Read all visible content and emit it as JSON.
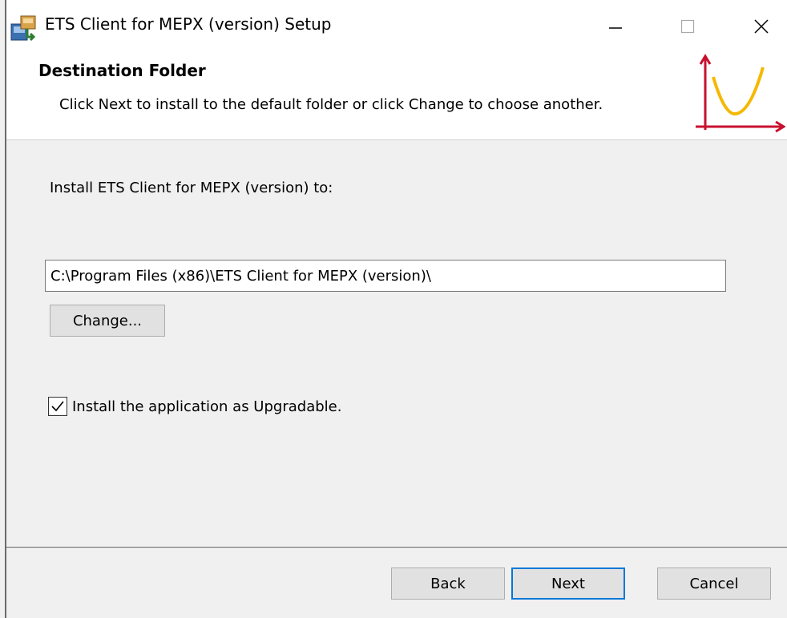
{
  "window": {
    "title": "ETS Client for MEPX (version) Setup"
  },
  "header": {
    "title": "Destination Folder",
    "subtitle": "Click Next to install to the default folder or click Change to choose another."
  },
  "main": {
    "install_label": "Install ETS Client for MEPX (version) to:",
    "install_path": "C:\\Program Files (x86)\\ETS Client for MEPX (version)\\",
    "change_label": "Change...",
    "upgradable_label": "Install the application as Upgradable.",
    "upgradable_checked": true
  },
  "footer": {
    "back_label": "Back",
    "next_label": "Next",
    "cancel_label": "Cancel"
  },
  "icons": {
    "app": "installer-icon",
    "logo": "chart-logo-icon",
    "minimize": "minimize-icon",
    "maximize": "maximize-icon",
    "close": "close-icon",
    "check": "checkmark-icon"
  },
  "colors": {
    "window_bg": "#f0f0f0",
    "header_bg": "#ffffff",
    "accent": "#0078d7",
    "logo_axis": "#c8102e",
    "logo_curve": "#f5b800"
  }
}
